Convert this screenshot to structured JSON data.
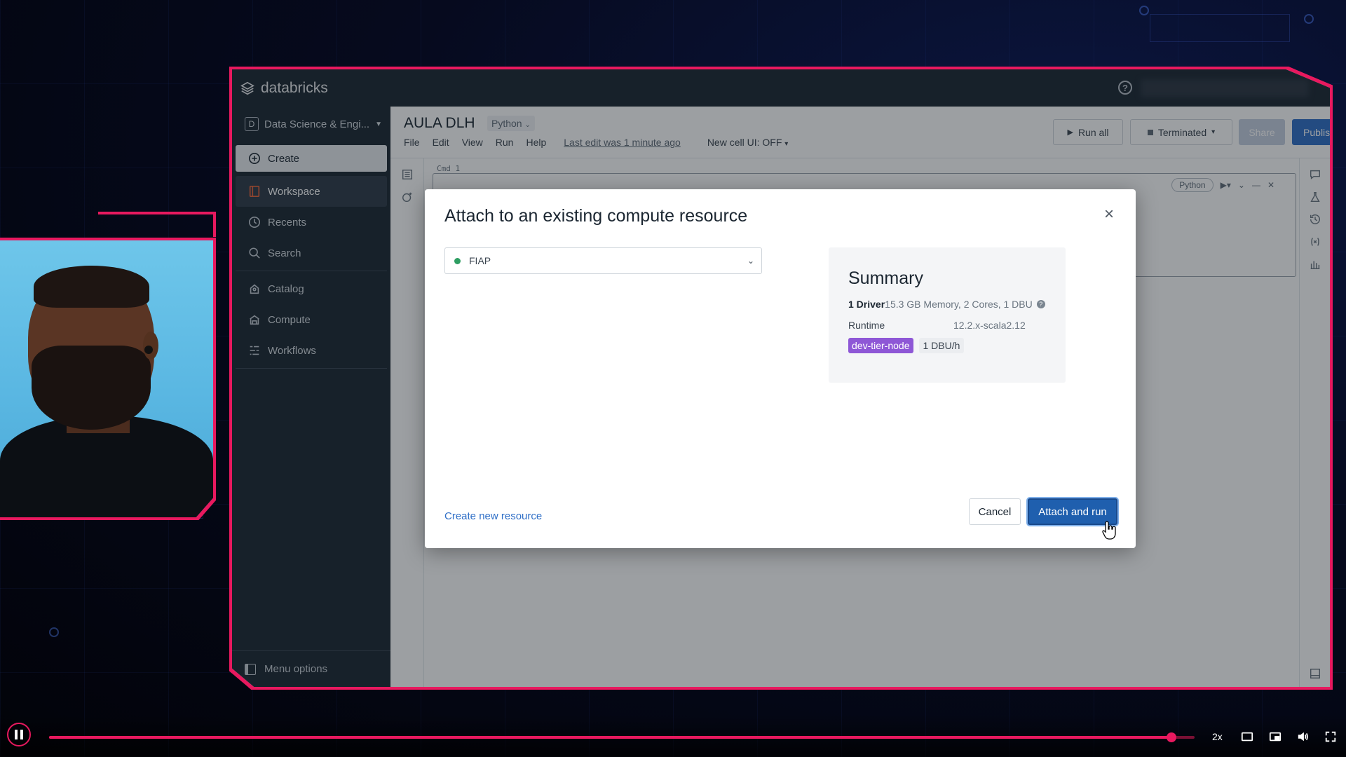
{
  "app": {
    "logo_text": "databricks",
    "help_glyph": "?"
  },
  "sidebar": {
    "workspace_badge": "D",
    "workspace_switcher": "Data Science & Engi...",
    "items": [
      {
        "label": "Create",
        "icon": "plus-circle-icon"
      },
      {
        "label": "Workspace",
        "icon": "workspace-icon"
      },
      {
        "label": "Recents",
        "icon": "clock-icon"
      },
      {
        "label": "Search",
        "icon": "search-icon"
      },
      {
        "label": "Catalog",
        "icon": "catalog-icon"
      },
      {
        "label": "Compute",
        "icon": "compute-icon"
      },
      {
        "label": "Workflows",
        "icon": "workflows-icon"
      }
    ],
    "menu_options": "Menu options"
  },
  "notebook": {
    "title": "AULA DLH",
    "language": "Python",
    "menu": [
      "File",
      "Edit",
      "View",
      "Run",
      "Help"
    ],
    "last_edit": "Last edit was 1 minute ago",
    "new_cell_ui": "New cell UI: OFF",
    "run_all": "Run all",
    "cluster_status": "Terminated",
    "share": "Share",
    "publish": "Publish",
    "cmd_label": "Cmd 1",
    "cell_language": "Python"
  },
  "modal": {
    "title": "Attach to an existing compute resource",
    "close_glyph": "×",
    "selected_resource": "FIAP",
    "summary": {
      "title": "Summary",
      "driver_count": "1 Driver",
      "driver_spec": "15.3 GB Memory, 2 Cores, 1 DBU",
      "runtime_label": "Runtime",
      "runtime_value": "12.2.x-scala2.12",
      "tag_node": "dev-tier-node",
      "tag_dbu": "1 DBU/h"
    },
    "create_link": "Create new resource",
    "cancel": "Cancel",
    "attach_and_run": "Attach and run"
  },
  "player": {
    "speed": "2x",
    "progress": 0.98
  },
  "colors": {
    "accent_frame": "#e8195f",
    "primary_button": "#1f5fae",
    "tag_purple": "#8e57d6",
    "status_dot": "#2e9e62"
  }
}
